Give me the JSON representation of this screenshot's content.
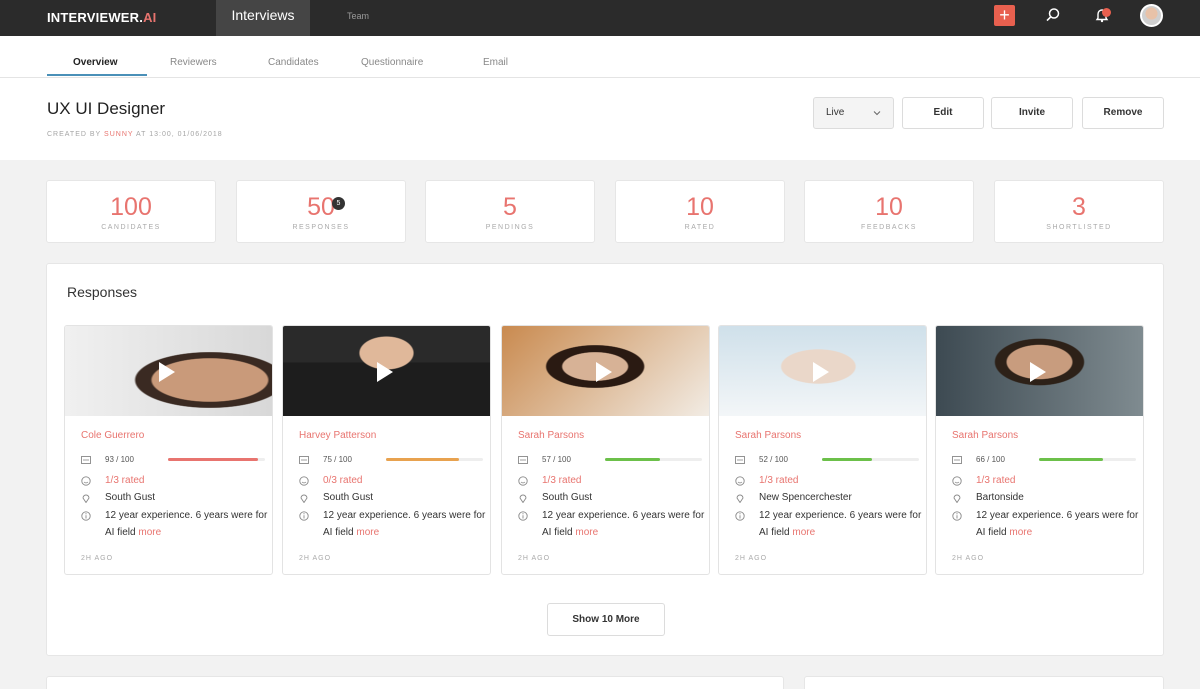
{
  "topbar": {
    "logo_main": "INTERVIEWER.",
    "logo_ai": "AI",
    "nav_active": "Interviews",
    "nav_team": "Team",
    "add_icon": "plus-icon",
    "search_icon": "search-icon",
    "bell_icon": "bell-icon",
    "accent": "#e8604f"
  },
  "tabs": [
    {
      "label": "Overview"
    },
    {
      "label": "Reviewers"
    },
    {
      "label": "Candidates"
    },
    {
      "label": "Questionnaire"
    },
    {
      "label": "Email"
    }
  ],
  "header": {
    "title": "UX UI Designer",
    "created_prefix": "CREATED BY",
    "created_by": "SUNNY",
    "created_suffix": "AT 13:00, 01/06/2018",
    "status_select": "Live",
    "edit_label": "Edit",
    "invite_label": "Invite",
    "remove_label": "Remove"
  },
  "stats": [
    {
      "value": "100",
      "label": "CANDIDATES"
    },
    {
      "value": "50",
      "label": "RESPONSES",
      "badge": "5"
    },
    {
      "value": "5",
      "label": "PENDINGS"
    },
    {
      "value": "10",
      "label": "RATED"
    },
    {
      "value": "10",
      "label": "FEEDBACKS"
    },
    {
      "value": "3",
      "label": "SHORTLISTED"
    }
  ],
  "responses": {
    "title": "Responses",
    "show_more": "Show 10 More",
    "cards": [
      {
        "name": "Cole Guerrero",
        "score": "93 / 100",
        "score_pct": 0.93,
        "bar_color": "#e8746f",
        "rated": "1/3 rated",
        "location": "South Gust",
        "desc": "12 year experience. 6 years were for AI field",
        "more": "more",
        "ago": "2H AGO"
      },
      {
        "name": "Harvey Patterson",
        "score": "75 / 100",
        "score_pct": 0.75,
        "bar_color": "#e8a24f",
        "rated": "0/3 rated",
        "location": "South Gust",
        "desc": "12 year experience. 6 years were for AI field",
        "more": "more",
        "ago": "2H AGO"
      },
      {
        "name": "Sarah Parsons",
        "score": "57 / 100",
        "score_pct": 0.57,
        "bar_color": "#6cc04a",
        "rated": "1/3 rated",
        "location": "South Gust",
        "desc": "12 year experience. 6 years were for AI field",
        "more": "more",
        "ago": "2H AGO"
      },
      {
        "name": "Sarah Parsons",
        "score": "52 / 100",
        "score_pct": 0.52,
        "bar_color": "#6cc04a",
        "rated": "1/3 rated",
        "location": "New Spencerchester",
        "desc": "12 year experience. 6 years were for AI field",
        "more": "more",
        "ago": "2H AGO"
      },
      {
        "name": "Sarah Parsons",
        "score": "66 / 100",
        "score_pct": 0.66,
        "bar_color": "#6cc04a",
        "rated": "1/3 rated",
        "location": "Bartonside",
        "desc": "12 year experience. 6 years were for AI field",
        "more": "more",
        "ago": "2H AGO"
      }
    ]
  }
}
